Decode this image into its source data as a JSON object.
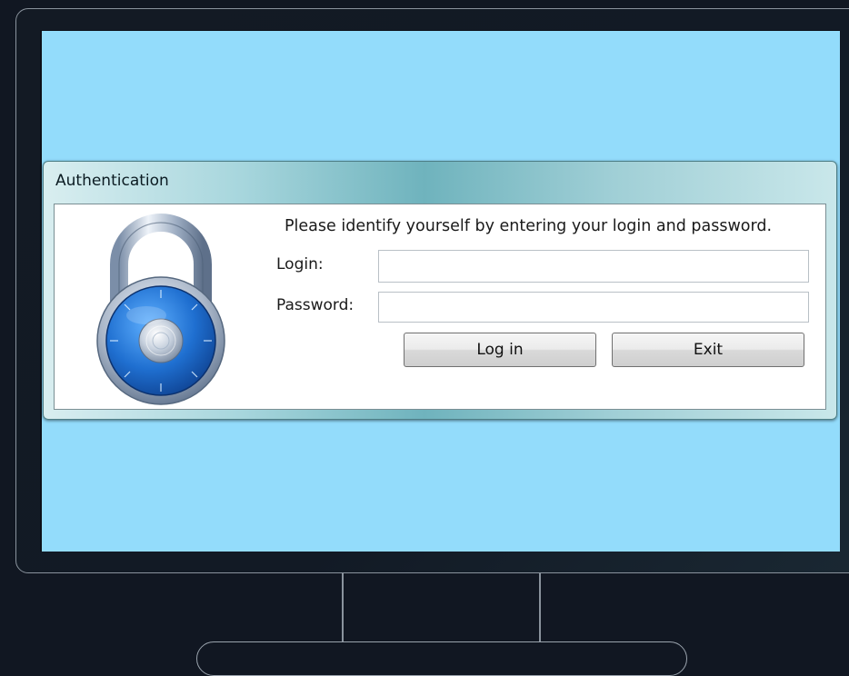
{
  "dialog": {
    "title": "Authentication",
    "prompt": "Please identify yourself by entering your login and password.",
    "login_label": "Login:",
    "password_label": "Password:",
    "login_value": "",
    "password_value": "",
    "login_button": "Log in",
    "exit_button": "Exit"
  },
  "icons": {
    "lock": "padlock-icon"
  },
  "colors": {
    "screen": "#93dcfb",
    "dial": "#1f6fd0",
    "frame": "#111722"
  }
}
